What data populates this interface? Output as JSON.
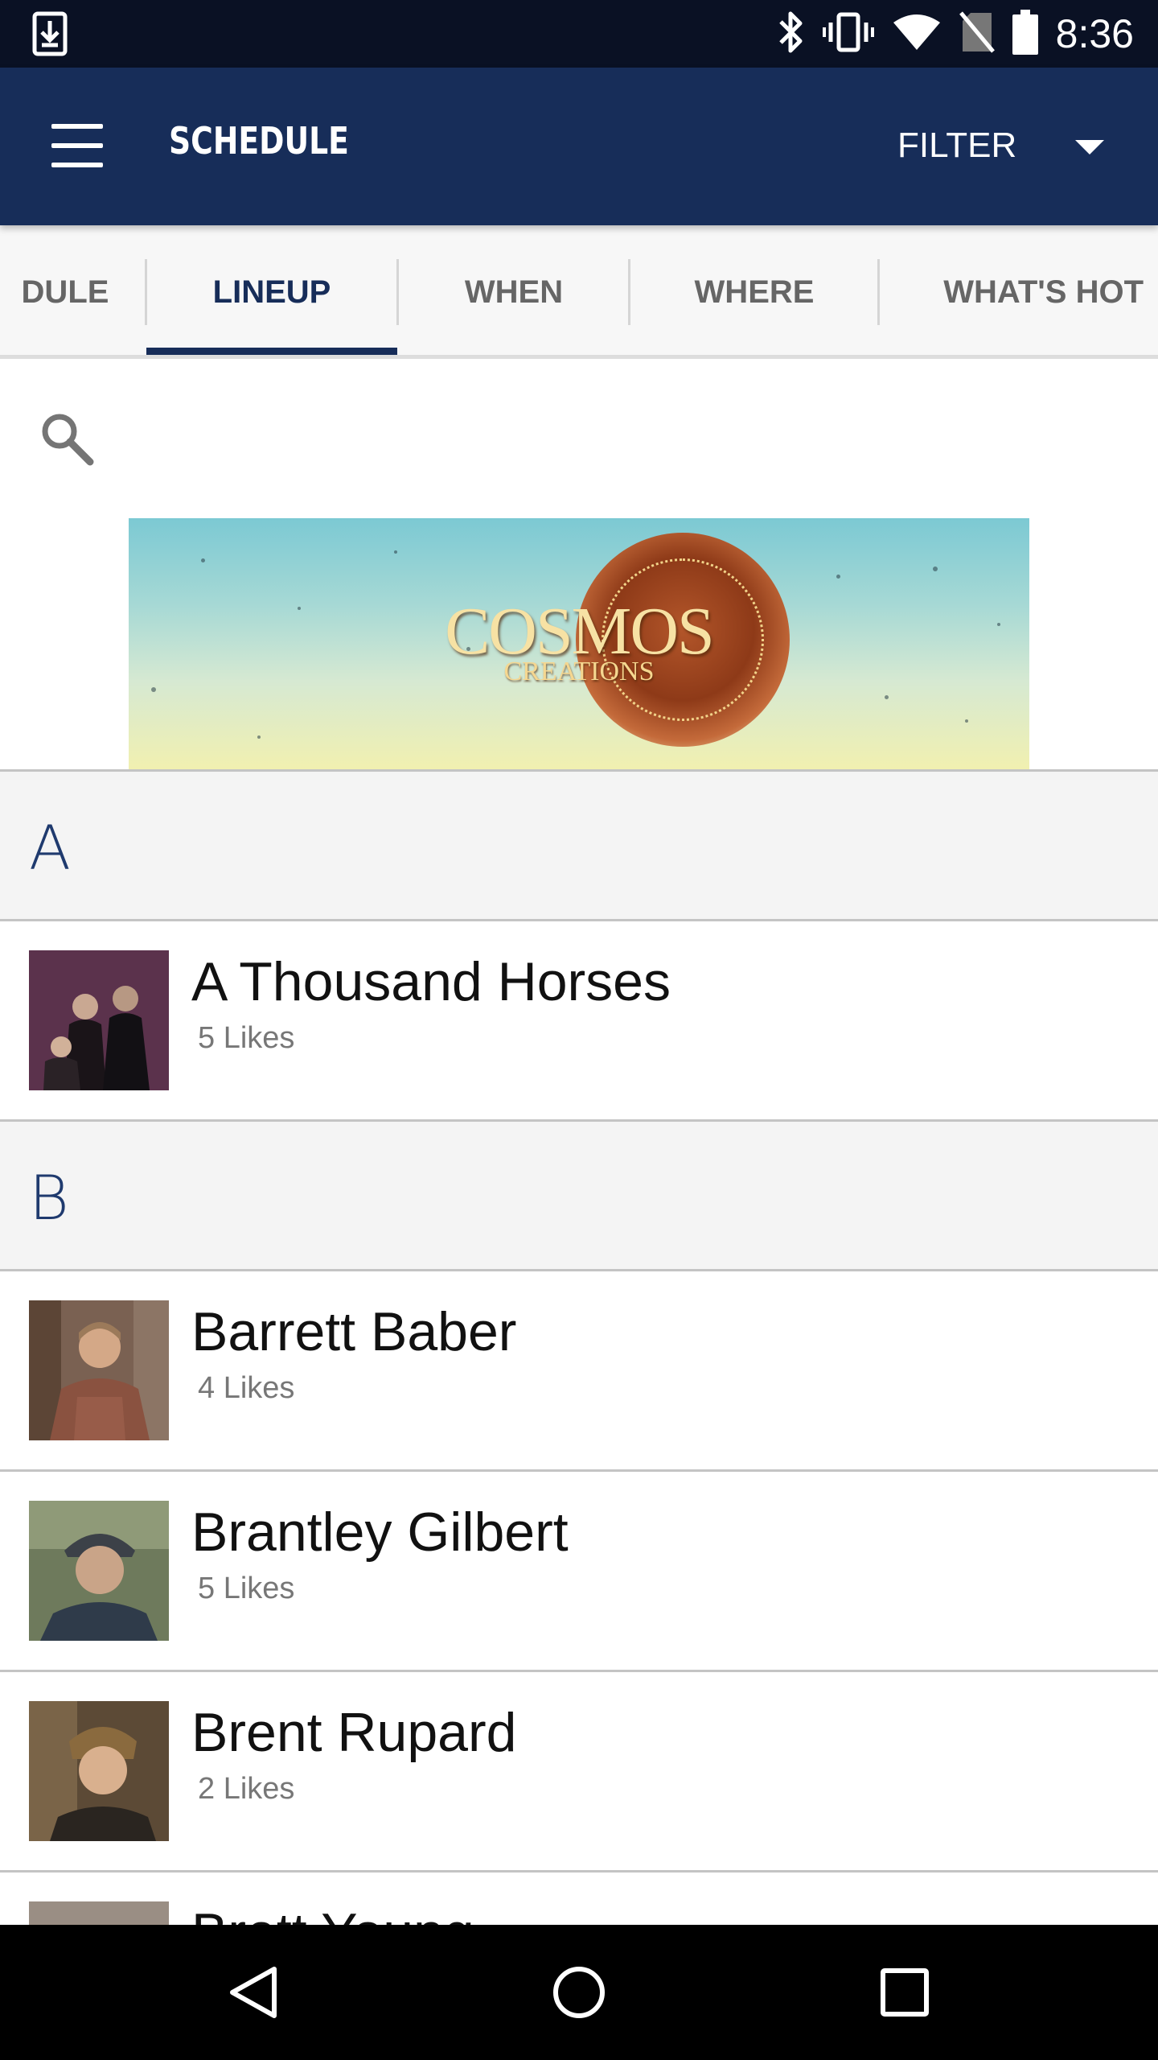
{
  "status_bar": {
    "time": "8:36",
    "icons": [
      "download-notification-icon",
      "bluetooth-icon",
      "vibrate-icon",
      "wifi-icon",
      "no-sim-icon",
      "battery-icon"
    ]
  },
  "app_bar": {
    "title": "SCHEDULE",
    "filter_label": "FILTER",
    "color": "#172d59"
  },
  "tabs": [
    {
      "label": "DULE",
      "active": false
    },
    {
      "label": "LINEUP",
      "active": true
    },
    {
      "label": "WHEN",
      "active": false
    },
    {
      "label": "WHERE",
      "active": false
    },
    {
      "label": "WHAT'S HOT",
      "active": false
    }
  ],
  "banner": {
    "logo_text": "COSMOS",
    "logo_subtext": "CREATIONS"
  },
  "sections": [
    {
      "letter": "A",
      "artists": [
        {
          "name": "A Thousand Horses",
          "likes": "5 Likes"
        }
      ]
    },
    {
      "letter": "B",
      "artists": [
        {
          "name": "Barrett Baber",
          "likes": "4 Likes"
        },
        {
          "name": "Brantley Gilbert",
          "likes": "5 Likes"
        },
        {
          "name": "Brent Rupard",
          "likes": "2 Likes"
        },
        {
          "name": "Brett Young",
          "likes": ""
        }
      ]
    }
  ],
  "nav_bar": {
    "icons": [
      "back-icon",
      "home-icon",
      "recents-icon"
    ]
  }
}
